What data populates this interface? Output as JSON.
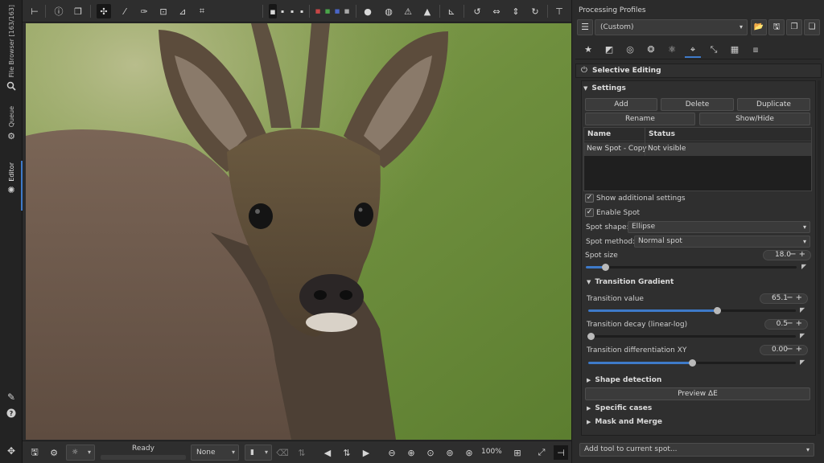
{
  "left_tabs": [
    {
      "label": "File Browser [163/163]",
      "icon": "folder-icon"
    },
    {
      "label": "Queue",
      "icon": "gears-icon"
    },
    {
      "label": "Editor",
      "icon": "aperture-icon"
    }
  ],
  "left_bottom_icons": [
    "wand-icon",
    "help-icon",
    "move-icon"
  ],
  "bottom_bar": {
    "status": "Ready",
    "crop_guide": "None",
    "zoom": "100%"
  },
  "panel": {
    "title": "Processing Profiles",
    "profile": "(Custom)",
    "selective_editing": "Selective Editing",
    "settings": "Settings",
    "buttons": {
      "add": "Add",
      "delete": "Delete",
      "duplicate": "Duplicate",
      "rename": "Rename",
      "show_hide": "Show/Hide"
    },
    "table": {
      "headers": [
        "Name",
        "Status"
      ],
      "rows": [
        [
          "New Spot - Copy",
          "Not visible"
        ]
      ]
    },
    "show_additional": "Show additional settings",
    "enable_spot": "Enable Spot",
    "spot_shape_label": "Spot shape:",
    "spot_shape": "Ellipse",
    "spot_method_label": "Spot method:",
    "spot_method": "Normal spot",
    "spot_size": {
      "label": "Spot size",
      "value": "18.0",
      "fraction": 0.09
    },
    "transition_gradient": "Transition Gradient",
    "transition_value": {
      "label": "Transition value",
      "value": "65.1",
      "fraction": 0.62
    },
    "transition_decay": {
      "label": "Transition decay (linear-log)",
      "value": "0.5",
      "fraction": 0.0
    },
    "transition_diff": {
      "label": "Transition differentiation XY",
      "value": "0.00",
      "fraction": 0.5
    },
    "shape_detection": "Shape detection",
    "preview_de": "Preview ΔE",
    "specific_cases": "Specific cases",
    "mask_merge": "Mask and Merge",
    "add_tool": "Add tool to current spot..."
  },
  "colors": {
    "accent": "#3e7ac9"
  }
}
